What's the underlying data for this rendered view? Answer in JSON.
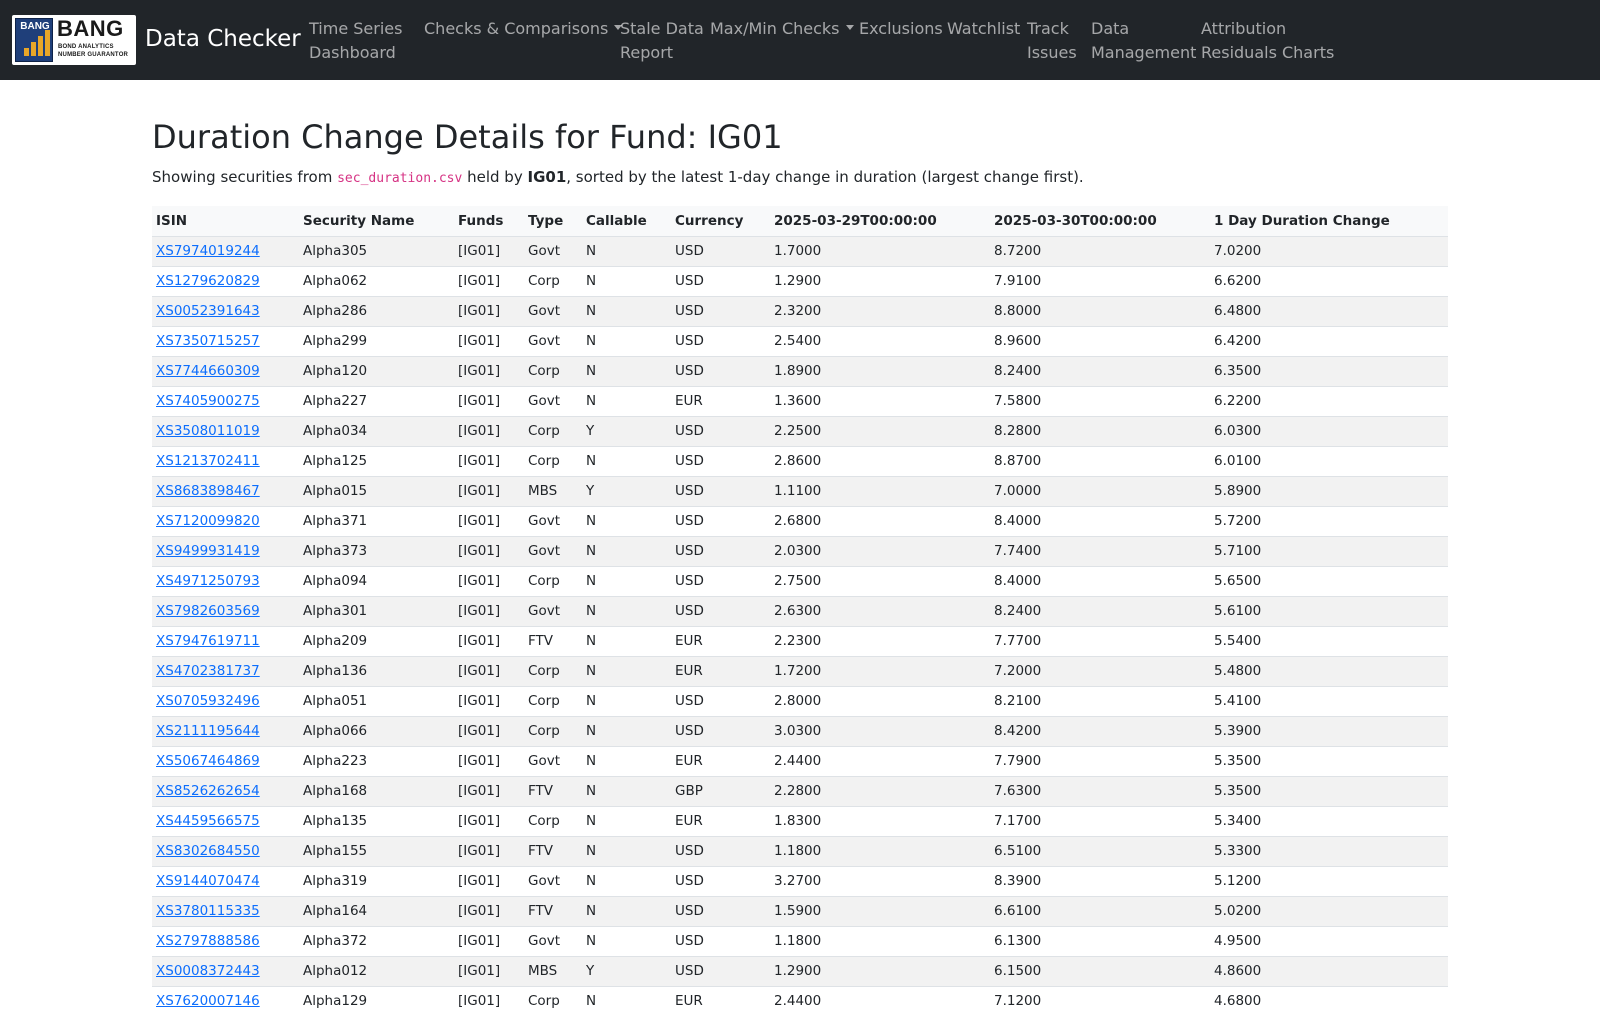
{
  "nav": {
    "logo_mark": "BANG",
    "logo_word": "BANG",
    "logo_sub1": "BOND ANALYTICS",
    "logo_sub2": "NUMBER GUARANTOR",
    "brand": "Data Checker",
    "links": [
      {
        "line1": "Time Series",
        "line2": "Dashboard"
      },
      {
        "line1": "Checks & Comparisons",
        "line2": ""
      },
      {
        "line1": "Stale Data",
        "line2": "Report"
      },
      {
        "line1": "Max/Min Checks",
        "line2": ""
      },
      {
        "line1": "Exclusions",
        "line2": ""
      },
      {
        "line1": "Watchlist",
        "line2": ""
      },
      {
        "line1": "Track",
        "line2": "Issues"
      },
      {
        "line1": "Data",
        "line2": "Management"
      },
      {
        "line1": "Attribution",
        "line2": "Residuals Charts"
      }
    ]
  },
  "page": {
    "title": "Duration Change Details for Fund: IG01",
    "subtitle_prefix": "Showing securities from ",
    "file": "sec_duration.csv",
    "subtitle_mid": " held by ",
    "fund": "IG01",
    "subtitle_suffix": ", sorted by the latest 1-day change in duration (largest change first)."
  },
  "table": {
    "headers": [
      "ISIN",
      "Security Name",
      "Funds",
      "Type",
      "Callable",
      "Currency",
      "2025-03-29T00:00:00",
      "2025-03-30T00:00:00",
      "1 Day Duration Change"
    ],
    "rows": [
      [
        "XS7974019244",
        "Alpha305",
        "[IG01]",
        "Govt",
        "N",
        "USD",
        "1.7000",
        "8.7200",
        "7.0200"
      ],
      [
        "XS1279620829",
        "Alpha062",
        "[IG01]",
        "Corp",
        "N",
        "USD",
        "1.2900",
        "7.9100",
        "6.6200"
      ],
      [
        "XS0052391643",
        "Alpha286",
        "[IG01]",
        "Govt",
        "N",
        "USD",
        "2.3200",
        "8.8000",
        "6.4800"
      ],
      [
        "XS7350715257",
        "Alpha299",
        "[IG01]",
        "Govt",
        "N",
        "USD",
        "2.5400",
        "8.9600",
        "6.4200"
      ],
      [
        "XS7744660309",
        "Alpha120",
        "[IG01]",
        "Corp",
        "N",
        "USD",
        "1.8900",
        "8.2400",
        "6.3500"
      ],
      [
        "XS7405900275",
        "Alpha227",
        "[IG01]",
        "Govt",
        "N",
        "EUR",
        "1.3600",
        "7.5800",
        "6.2200"
      ],
      [
        "XS3508011019",
        "Alpha034",
        "[IG01]",
        "Corp",
        "Y",
        "USD",
        "2.2500",
        "8.2800",
        "6.0300"
      ],
      [
        "XS1213702411",
        "Alpha125",
        "[IG01]",
        "Corp",
        "N",
        "USD",
        "2.8600",
        "8.8700",
        "6.0100"
      ],
      [
        "XS8683898467",
        "Alpha015",
        "[IG01]",
        "MBS",
        "Y",
        "USD",
        "1.1100",
        "7.0000",
        "5.8900"
      ],
      [
        "XS7120099820",
        "Alpha371",
        "[IG01]",
        "Govt",
        "N",
        "USD",
        "2.6800",
        "8.4000",
        "5.7200"
      ],
      [
        "XS9499931419",
        "Alpha373",
        "[IG01]",
        "Govt",
        "N",
        "USD",
        "2.0300",
        "7.7400",
        "5.7100"
      ],
      [
        "XS4971250793",
        "Alpha094",
        "[IG01]",
        "Corp",
        "N",
        "USD",
        "2.7500",
        "8.4000",
        "5.6500"
      ],
      [
        "XS7982603569",
        "Alpha301",
        "[IG01]",
        "Govt",
        "N",
        "USD",
        "2.6300",
        "8.2400",
        "5.6100"
      ],
      [
        "XS7947619711",
        "Alpha209",
        "[IG01]",
        "FTV",
        "N",
        "EUR",
        "2.2300",
        "7.7700",
        "5.5400"
      ],
      [
        "XS4702381737",
        "Alpha136",
        "[IG01]",
        "Corp",
        "N",
        "EUR",
        "1.7200",
        "7.2000",
        "5.4800"
      ],
      [
        "XS0705932496",
        "Alpha051",
        "[IG01]",
        "Corp",
        "N",
        "USD",
        "2.8000",
        "8.2100",
        "5.4100"
      ],
      [
        "XS2111195644",
        "Alpha066",
        "[IG01]",
        "Corp",
        "N",
        "USD",
        "3.0300",
        "8.4200",
        "5.3900"
      ],
      [
        "XS5067464869",
        "Alpha223",
        "[IG01]",
        "Govt",
        "N",
        "EUR",
        "2.4400",
        "7.7900",
        "5.3500"
      ],
      [
        "XS8526262654",
        "Alpha168",
        "[IG01]",
        "FTV",
        "N",
        "GBP",
        "2.2800",
        "7.6300",
        "5.3500"
      ],
      [
        "XS4459566575",
        "Alpha135",
        "[IG01]",
        "Corp",
        "N",
        "EUR",
        "1.8300",
        "7.1700",
        "5.3400"
      ],
      [
        "XS8302684550",
        "Alpha155",
        "[IG01]",
        "FTV",
        "N",
        "USD",
        "1.1800",
        "6.5100",
        "5.3300"
      ],
      [
        "XS9144070474",
        "Alpha319",
        "[IG01]",
        "Govt",
        "N",
        "USD",
        "3.2700",
        "8.3900",
        "5.1200"
      ],
      [
        "XS3780115335",
        "Alpha164",
        "[IG01]",
        "FTV",
        "N",
        "USD",
        "1.5900",
        "6.6100",
        "5.0200"
      ],
      [
        "XS2797888586",
        "Alpha372",
        "[IG01]",
        "Govt",
        "N",
        "USD",
        "1.1800",
        "6.1300",
        "4.9500"
      ],
      [
        "XS0008372443",
        "Alpha012",
        "[IG01]",
        "MBS",
        "Y",
        "USD",
        "1.2900",
        "6.1500",
        "4.8600"
      ],
      [
        "XS7620007146",
        "Alpha129",
        "[IG01]",
        "Corp",
        "N",
        "EUR",
        "2.4400",
        "7.1200",
        "4.6800"
      ]
    ]
  },
  "colors": {
    "navbar": "#212529",
    "link": "#0d6efd",
    "code": "#d63384",
    "stripe": "#f2f2f2"
  }
}
